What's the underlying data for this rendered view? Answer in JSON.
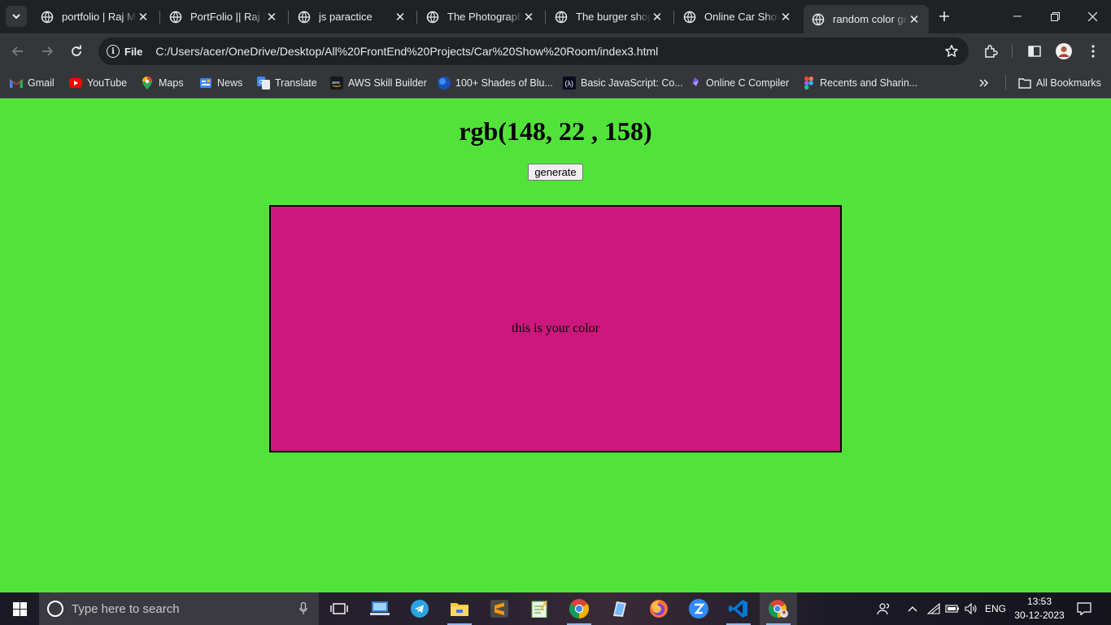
{
  "browser": {
    "tabs": [
      {
        "title": "portfolio | Raj Mi"
      },
      {
        "title": "PortFolio || Raj M"
      },
      {
        "title": "js paractice"
      },
      {
        "title": "The Photograph"
      },
      {
        "title": "The burger shop"
      },
      {
        "title": "Online Car Show"
      },
      {
        "title": "random color ge",
        "active": true
      }
    ],
    "site_chip": "File",
    "url": "C:/Users/acer/OneDrive/Desktop/All%20FrontEnd%20Projects/Car%20Show%20Room/index3.html"
  },
  "bookmarks": [
    {
      "label": "Gmail",
      "icon": "gmail-icon"
    },
    {
      "label": "YouTube",
      "icon": "youtube-icon"
    },
    {
      "label": "Maps",
      "icon": "maps-icon"
    },
    {
      "label": "News",
      "icon": "news-icon"
    },
    {
      "label": "Translate",
      "icon": "translate-icon"
    },
    {
      "label": "AWS Skill Builder",
      "icon": "aws-icon"
    },
    {
      "label": "100+ Shades of Blu...",
      "icon": "globe-blue-icon"
    },
    {
      "label": "Basic JavaScript: Co...",
      "icon": "freecodecamp-icon"
    },
    {
      "label": "Online C Compiler",
      "icon": "compiler-icon"
    },
    {
      "label": "Recents and Sharin...",
      "icon": "figma-icon"
    }
  ],
  "all_bookmarks_label": "All Bookmarks",
  "page": {
    "background_color": "#52e33a",
    "heading": "rgb(148, 22 , 158)",
    "generate_label": "generate",
    "box_text": "this is your color",
    "box_color": "#cc177d"
  },
  "taskbar": {
    "search_placeholder": "Type here to search",
    "language": "ENG",
    "time": "13:53",
    "date": "30-12-2023"
  }
}
